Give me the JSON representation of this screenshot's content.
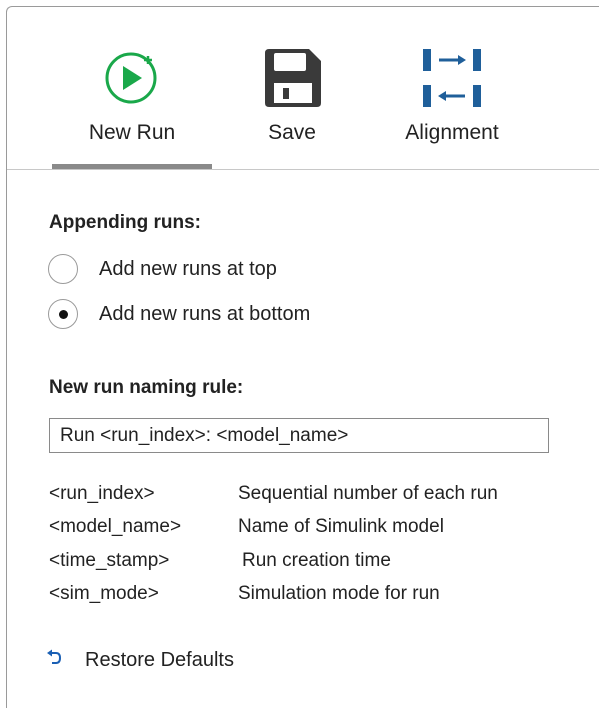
{
  "toolbar": {
    "new_run_label": "New Run",
    "save_label": "Save",
    "alignment_label": "Alignment"
  },
  "appending": {
    "title": "Appending runs:",
    "options": [
      {
        "label": "Add new runs at top",
        "checked": false
      },
      {
        "label": "Add new runs at bottom",
        "checked": true
      }
    ]
  },
  "naming": {
    "title": "New run naming rule:",
    "value": "Run <run_index>: <model_name>",
    "tokens": [
      {
        "token": "<run_index>",
        "description": "Sequential number of each run"
      },
      {
        "token": "<model_name>",
        "description": "Name of Simulink model"
      },
      {
        "token": "<time_stamp>",
        "description": "Run creation time"
      },
      {
        "token": "<sim_mode>",
        "description": "Simulation mode for run"
      }
    ]
  },
  "restore_label": "Restore Defaults",
  "colors": {
    "accent_green": "#1aa84a",
    "align_blue": "#1f5f9a",
    "restore_blue": "#1a5fb4",
    "icon_dark": "#3a3a3a"
  },
  "icons": {
    "new_run": "play-plus-icon",
    "save": "floppy-disk-icon",
    "alignment": "align-arrows-icon",
    "restore": "undo-icon"
  }
}
